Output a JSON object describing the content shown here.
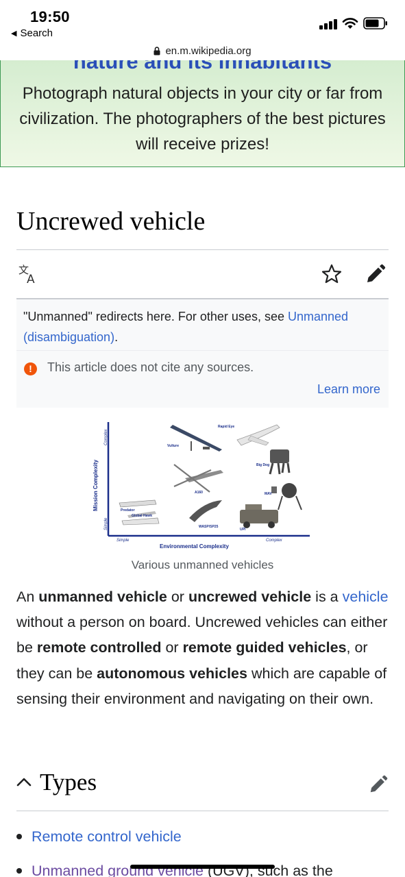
{
  "status_bar": {
    "time": "19:50",
    "back_label": "Search"
  },
  "browser": {
    "url": "en.m.wikipedia.org"
  },
  "banner": {
    "title": "nature and its inhabitants",
    "text": "Photograph natural objects in your city or far from civilization. The photographers of the best pictures will receive prizes!"
  },
  "article": {
    "title": "Uncrewed vehicle",
    "hatnote_text": "\"Unmanned\" redirects here. For other uses, see ",
    "hatnote_link": "Unmanned (disambiguation)",
    "hatnote_end": ".",
    "warning_text": "This article does not cite any sources.",
    "learn_more": "Learn more",
    "figure": {
      "caption": "Various unmanned vehicles",
      "y_axis": "Mission Complexity",
      "x_axis": "Environmental Complexity",
      "x_low": "Simple",
      "x_high": "Complex",
      "y_low": "Simple",
      "y_high": "Complex",
      "labels": [
        "Rapid Eye",
        "Vulture",
        "Big Dog",
        "A160",
        "MAV",
        "Predator",
        "Global Hawk",
        "WASP/SP25",
        "UPI"
      ]
    },
    "paragraph": {
      "p1": "An ",
      "b1": "unmanned vehicle",
      "p2": " or ",
      "b2": "uncrewed vehicle",
      "p3": " is a ",
      "link1": "vehicle",
      "p4": " without a person on board. Uncrewed vehicles can either be ",
      "b3": "remote controlled",
      "p5": " or ",
      "b4": "remote guided vehicles",
      "p6": ", or they can be ",
      "b5": "autonomous vehicles",
      "p7": " which are capable of sensing their environment and navigating on their own."
    },
    "section": {
      "title": "Types"
    },
    "types_list": {
      "item1": "Remote control vehicle",
      "item2_link": "Unmanned ground vehicle",
      "item2_text": " (UGV), such as the"
    }
  },
  "colors": {
    "link": "#3366cc",
    "visited_link": "#6b4ba1",
    "banner_border": "#3f9a55",
    "banner_title": "#2a4fb8",
    "warning": "#f0550a"
  },
  "icons": [
    "back-triangle-icon",
    "signal-icon",
    "wifi-icon",
    "battery-icon",
    "lock-icon",
    "language-icon",
    "star-icon",
    "edit-pencil-icon",
    "warning-icon",
    "chevron-up-icon"
  ]
}
